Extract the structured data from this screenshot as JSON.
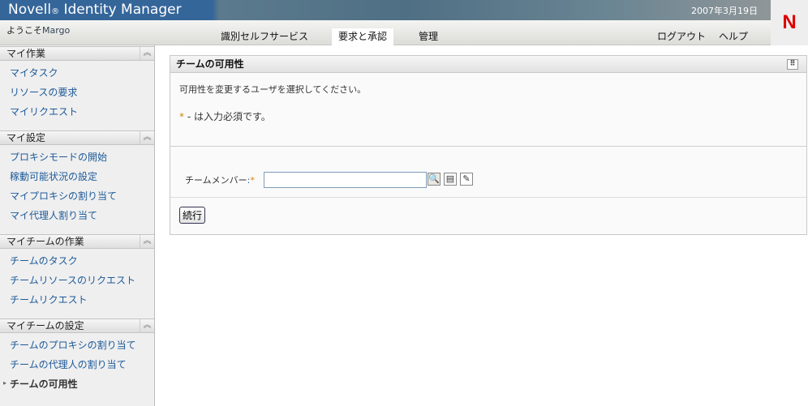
{
  "header": {
    "title": "Novell",
    "title_reg": "®",
    "title_rest": " Identity Manager",
    "date": "2007年3月19日",
    "logo": "N",
    "welcome": "ようこそ",
    "user": "Margo"
  },
  "tabs": [
    {
      "label": "識別セルフサービス"
    },
    {
      "label": "要求と承認"
    },
    {
      "label": "管理"
    }
  ],
  "top_links": {
    "logout": "ログアウト",
    "help": "ヘルプ"
  },
  "sidebar": [
    {
      "title": "マイ作業",
      "items": [
        "マイタスク",
        "リソースの要求",
        "マイリクエスト"
      ]
    },
    {
      "title": "マイ設定",
      "items": [
        "プロキシモードの開始",
        "稼動可能状況の設定",
        "マイプロキシの割り当て",
        "マイ代理人割り当て"
      ]
    },
    {
      "title": "マイチームの作業",
      "items": [
        "チームのタスク",
        "チームリソースのリクエスト",
        "チームリクエスト"
      ]
    },
    {
      "title": "マイチームの設定",
      "items": [
        "チームのプロキシの割り当て",
        "チームの代理人の割り当て",
        "チームの可用性"
      ]
    }
  ],
  "panel": {
    "title": "チームの可用性",
    "instruction": "可用性を変更するユーザを選択してください。",
    "required_star": "*",
    "required_note": " - は入力必須です。",
    "field_label": "チームメンバー",
    "field_colon": ":",
    "field_value": "",
    "button": "続行"
  }
}
